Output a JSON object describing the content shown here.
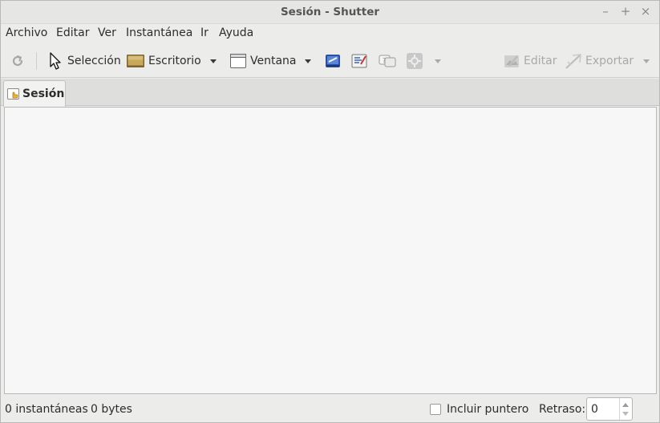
{
  "window": {
    "title": "Sesión - Shutter",
    "controls": {
      "minimize": "–",
      "maximize": "+",
      "close": "×"
    }
  },
  "menubar": {
    "items": [
      {
        "label": "Archivo"
      },
      {
        "label": "Editar"
      },
      {
        "label": "Ver"
      },
      {
        "label": "Instantánea"
      },
      {
        "label": "Ir"
      },
      {
        "label": "Ayuda"
      }
    ]
  },
  "toolbar": {
    "redo_icon": "redo-icon",
    "selection_label": "Selección",
    "desktop_label": "Escritorio",
    "window_label": "Ventana",
    "edit_label": "Editar",
    "export_label": "Exportar",
    "colors": {
      "desktop_icon": "#b8963e",
      "disabled": "#a9a9a9"
    }
  },
  "tabs": [
    {
      "label": "Sesión",
      "icon": "session-hand-icon"
    }
  ],
  "statusbar": {
    "snapshots": "0 instantáneas",
    "size": "0 bytes",
    "include_pointer_label": "Incluir puntero",
    "include_pointer_checked": false,
    "delay_label": "Retraso:",
    "delay_value": "0"
  }
}
